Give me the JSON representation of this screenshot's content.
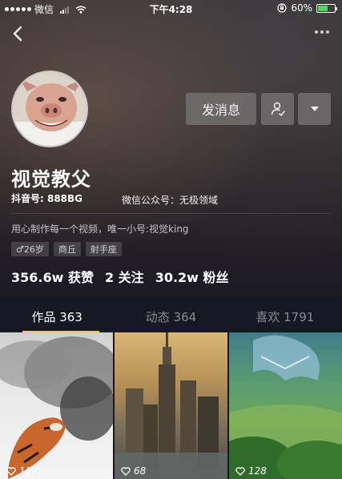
{
  "status_bar": {
    "carrier": "微信",
    "time": "下午4:28",
    "battery": "60%",
    "battery_level": 0.6
  },
  "profile": {
    "nickname": "视觉教父",
    "douyin_id": "抖音号: 888BG",
    "watermark": "微信公众号：无极领域",
    "bio": "用心制作每一个视频，唯一小号:视觉king",
    "tags": [
      "♂26岁",
      "商丘",
      "射手座"
    ],
    "stats": {
      "likes": "356.6w 获赞",
      "following": "2 关注",
      "followers": "30.2w 粉丝"
    }
  },
  "actions": {
    "message_label": "发消息"
  },
  "tabs": [
    {
      "label": "作品 363",
      "active": true
    },
    {
      "label": "动态 364",
      "active": false
    },
    {
      "label": "喜欢 1791",
      "active": false
    }
  ],
  "videos": [
    {
      "likes": "117"
    },
    {
      "likes": "68"
    },
    {
      "likes": "128"
    }
  ],
  "colors": {
    "background": "#161823",
    "tab_indicator": "#face15",
    "battery": "#4cd964"
  }
}
